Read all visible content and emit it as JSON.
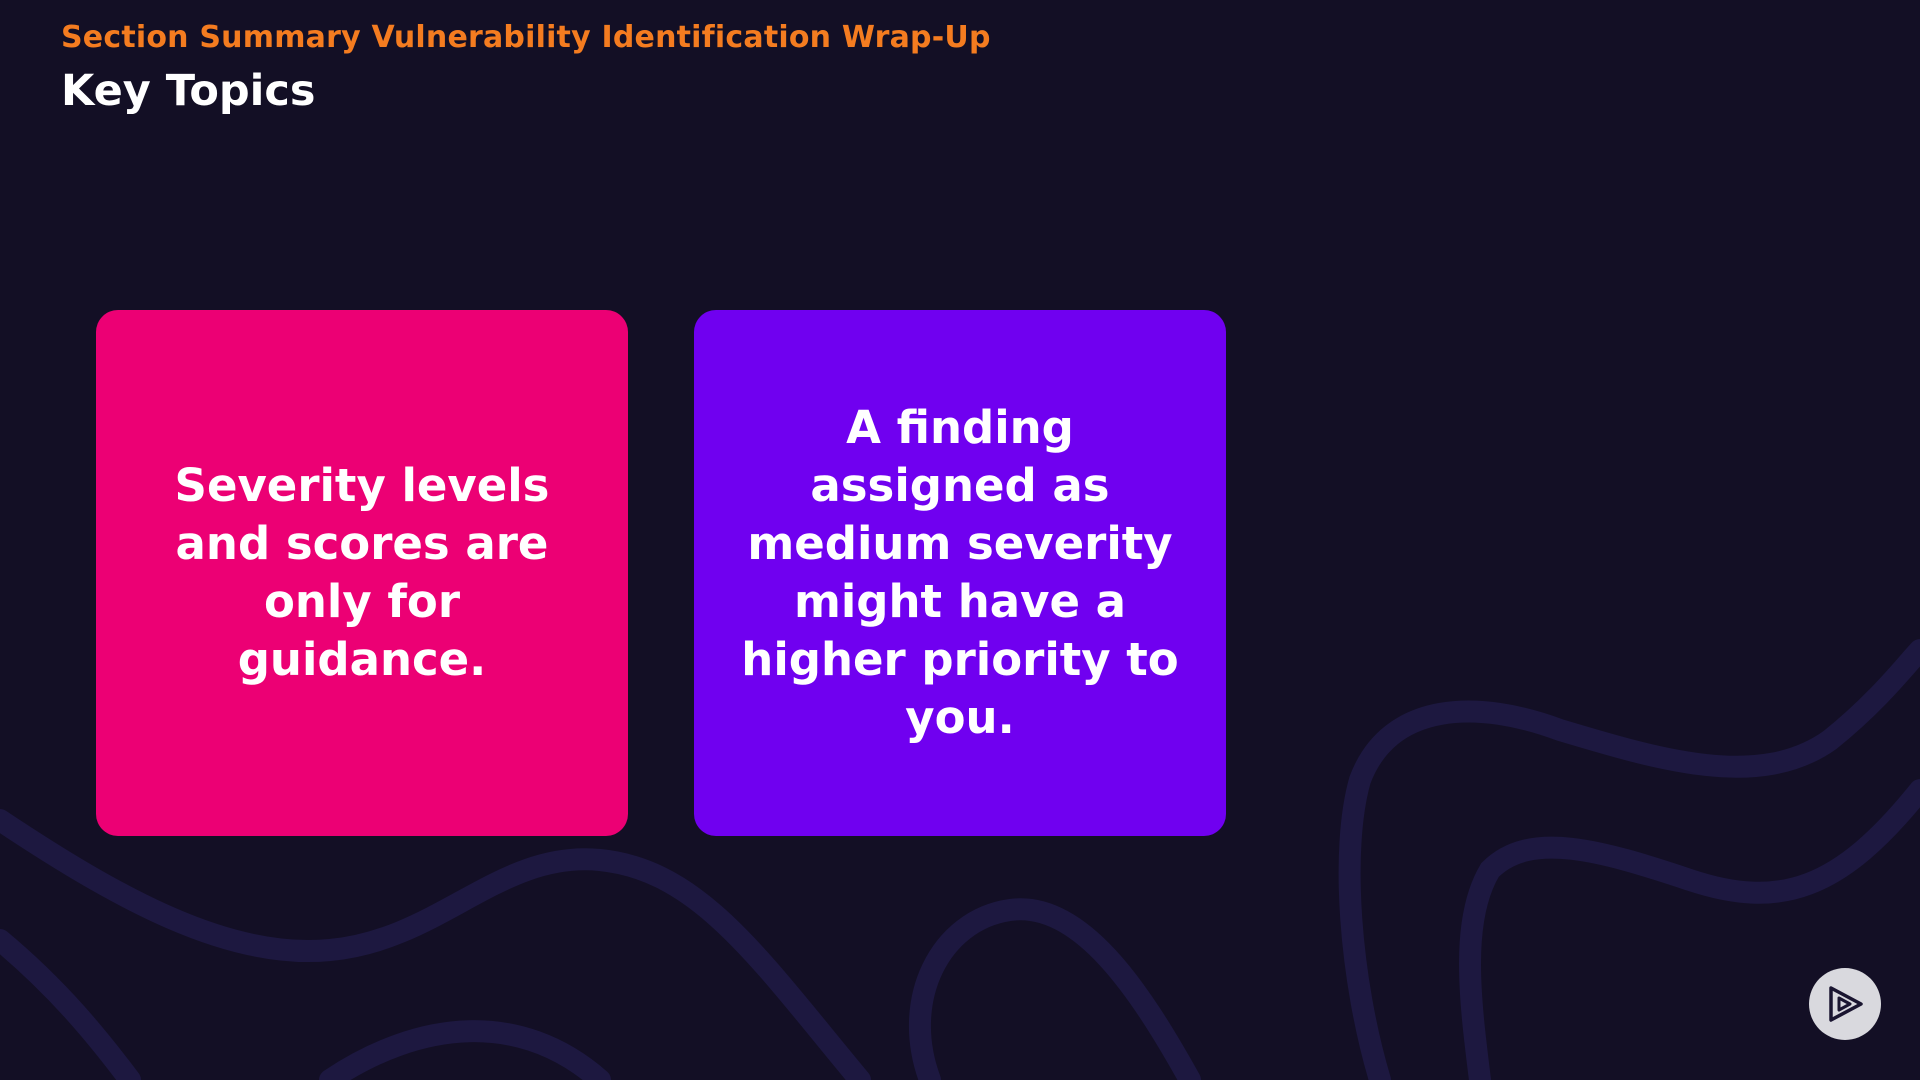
{
  "header": {
    "section_label": "Section Summary Vulnerability Identification Wrap-Up",
    "title": "Key Topics"
  },
  "cards": [
    {
      "text": "Severity levels and scores are only for guidance.",
      "color": "#ec0074"
    },
    {
      "text": "A finding assigned as medium severity might have a higher priority to you.",
      "color": "#7000f0"
    }
  ],
  "controls": {
    "play_icon": "play-icon"
  },
  "colors": {
    "background": "#130f25",
    "accent": "#f47c20",
    "swirl": "#1d1840"
  }
}
